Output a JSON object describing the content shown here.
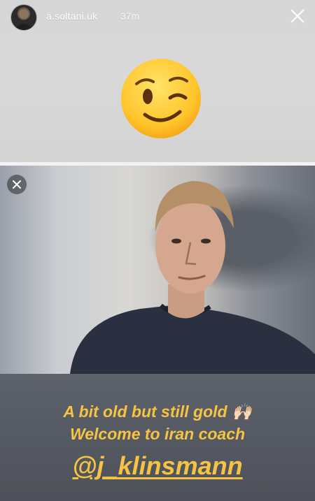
{
  "header": {
    "username": "a.soltani.uk",
    "timestamp": "37m",
    "avatar_icon": "profile-avatar",
    "close_icon": "close-icon"
  },
  "sticker": {
    "emoji": "winking-face"
  },
  "photo": {
    "remove_icon": "close-icon"
  },
  "caption": {
    "line1": "A bit old but still gold 🙌🏻",
    "line2": "Welcome to iran coach",
    "mention": "@j_klinsmann"
  },
  "colors": {
    "caption_text": "#f6c343",
    "caption_bg": "#555961",
    "top_bg": "#d7d7d7"
  }
}
